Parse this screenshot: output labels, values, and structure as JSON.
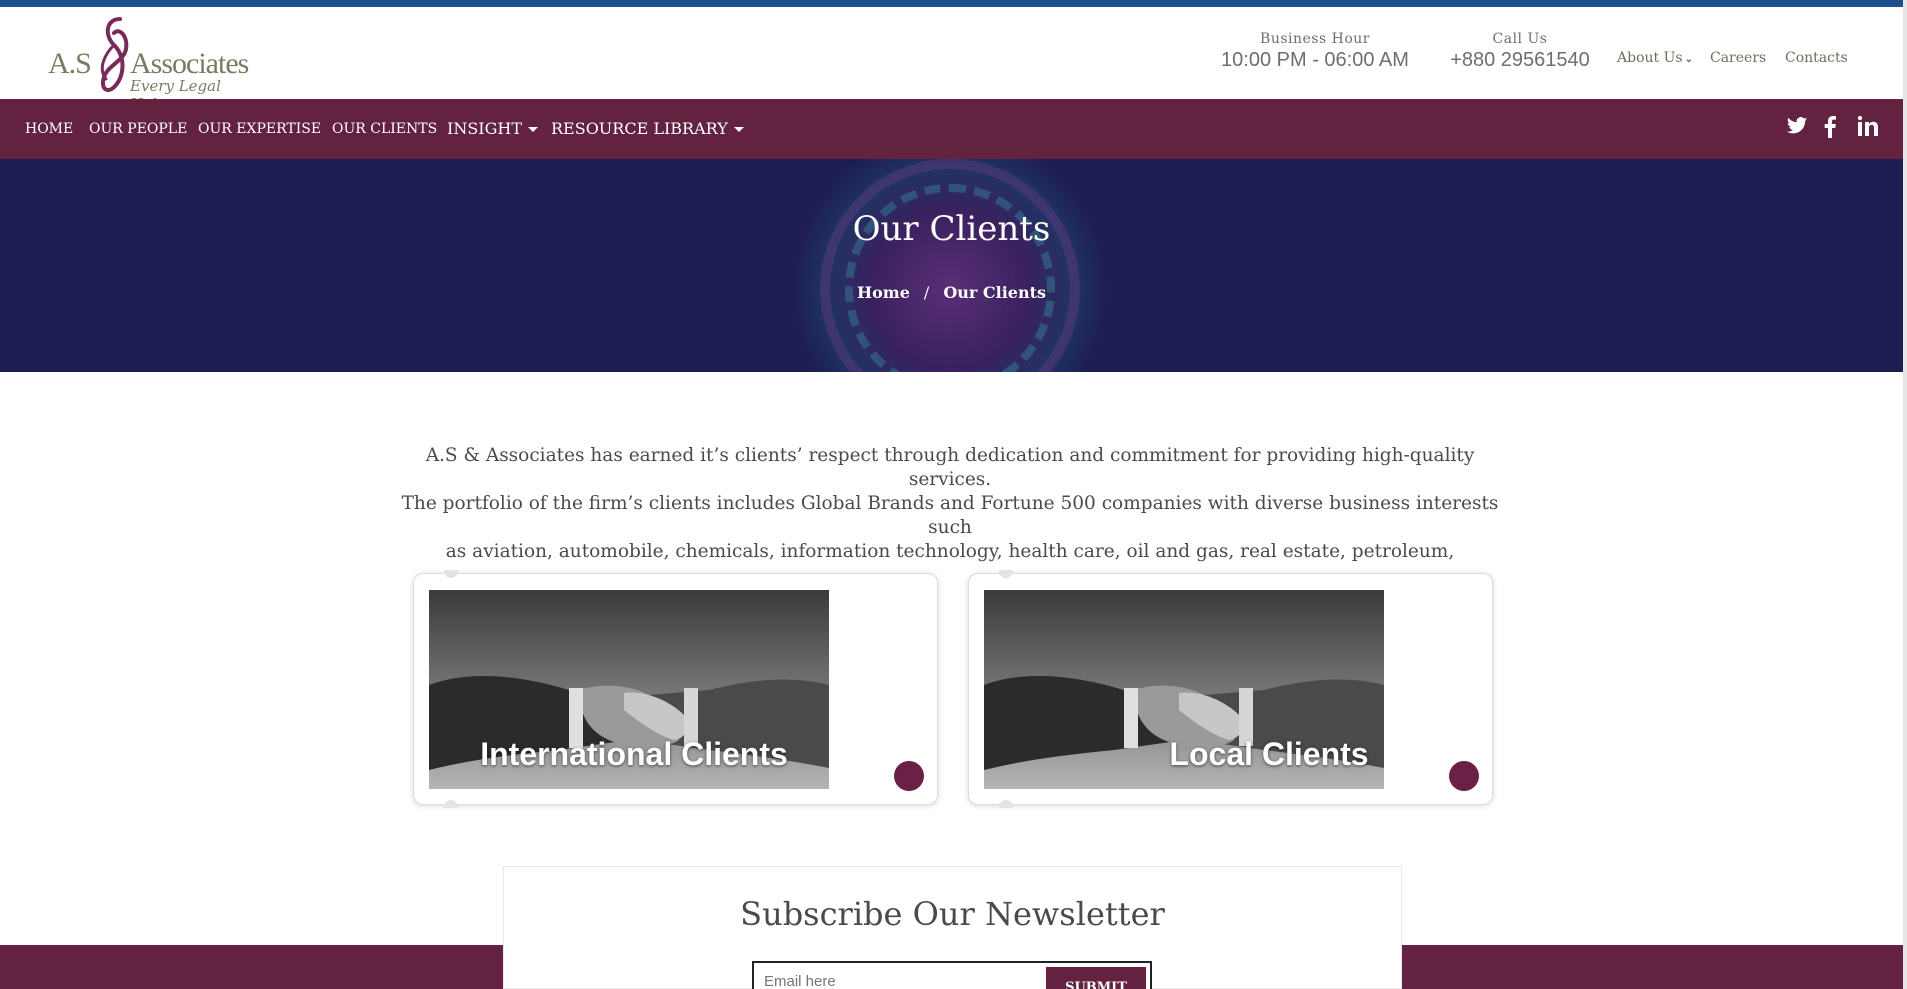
{
  "brand": {
    "logo_left": "A.S",
    "logo_right": "Associates",
    "tagline": "Every Legal Help"
  },
  "header": {
    "business_hour_label": "Business Hour",
    "business_hour_value": "10:00 PM - 06:00 AM",
    "call_label": "Call Us",
    "call_value": "+880 29561540",
    "links": {
      "about": "About Us",
      "careers": "Careers",
      "contacts": "Contacts"
    }
  },
  "nav": {
    "items": [
      "HOME",
      "OUR PEOPLE",
      "OUR EXPERTISE",
      "OUR CLIENTS",
      "INSIGHT",
      "RESOURCE LIBRARY"
    ],
    "social": {
      "twitter": "twitter-icon",
      "facebook": "facebook-icon",
      "linkedin": "linkedin-icon"
    }
  },
  "hero": {
    "title": "Our Clients",
    "breadcrumb": [
      "Home",
      "/",
      "Our Clients"
    ]
  },
  "intro": {
    "line1": "A.S & Associates has earned it’s clients’ respect through dedication and commitment for providing high-quality services.",
    "line2": "The portfolio of the firm’s clients includes Global Brands and Fortune 500 companies with diverse business interests such",
    "line3": "as aviation, automobile, chemicals, information technology, health care, oil and gas, real estate, petroleum,"
  },
  "cards": [
    {
      "title": "International Clients"
    },
    {
      "title": "Local Clients"
    }
  ],
  "newsletter": {
    "title": "Subscribe Our Newsletter",
    "placeholder": "Email here",
    "submit": "SUBMIT"
  },
  "colors": {
    "brand_plum": "#632240",
    "hero_navy": "#1d1d52",
    "top_line": "#1d4f8c"
  }
}
